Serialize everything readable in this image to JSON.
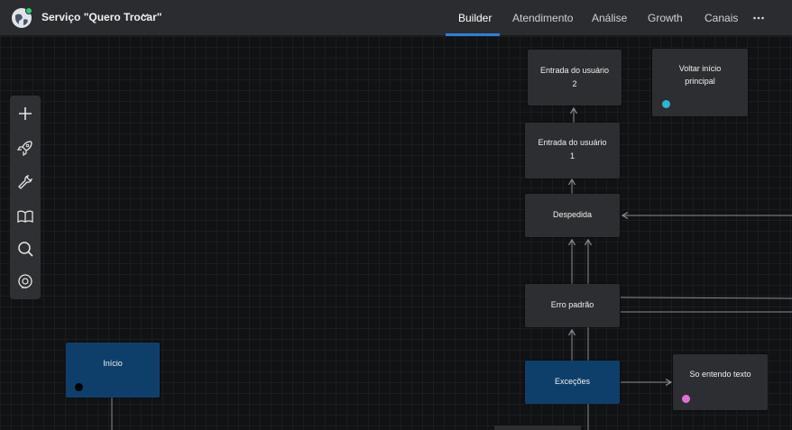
{
  "header": {
    "bot_name": "Serviço \"Quero Trocar\"",
    "tabs": [
      {
        "label": "Builder",
        "active": true
      },
      {
        "label": "Atendimento",
        "active": false
      },
      {
        "label": "Análise",
        "active": false
      },
      {
        "label": "Growth",
        "active": false
      },
      {
        "label": "Canais",
        "active": false
      }
    ],
    "more_icon": "more-horizontal-icon"
  },
  "palette": {
    "tools": [
      "plus-icon",
      "rocket-icon",
      "wrench-icon",
      "book-icon",
      "search-icon",
      "support-icon"
    ]
  },
  "nodes": {
    "entrada2": {
      "line1": "Entrada do usuário",
      "line2": "2"
    },
    "voltar": {
      "line1": "Voltar início",
      "line2": "principal",
      "dot_color": "#29b6d8"
    },
    "entrada1": {
      "line1": "Entrada do usuário",
      "line2": "1"
    },
    "despedida": {
      "line1": "Despedida"
    },
    "erro": {
      "line1": "Erro padrão"
    },
    "inicio": {
      "line1": "Início",
      "dot_color": "#000000"
    },
    "excecoes": {
      "line1": "Exceções"
    },
    "so_entendo": {
      "line1": "So entendo texto",
      "dot_color": "#e070d8"
    }
  },
  "colors": {
    "accent": "#2f7de1",
    "node_bg": "#2d2e31",
    "node_blue": "#0e3f6b",
    "edge": "#8a8c90"
  }
}
